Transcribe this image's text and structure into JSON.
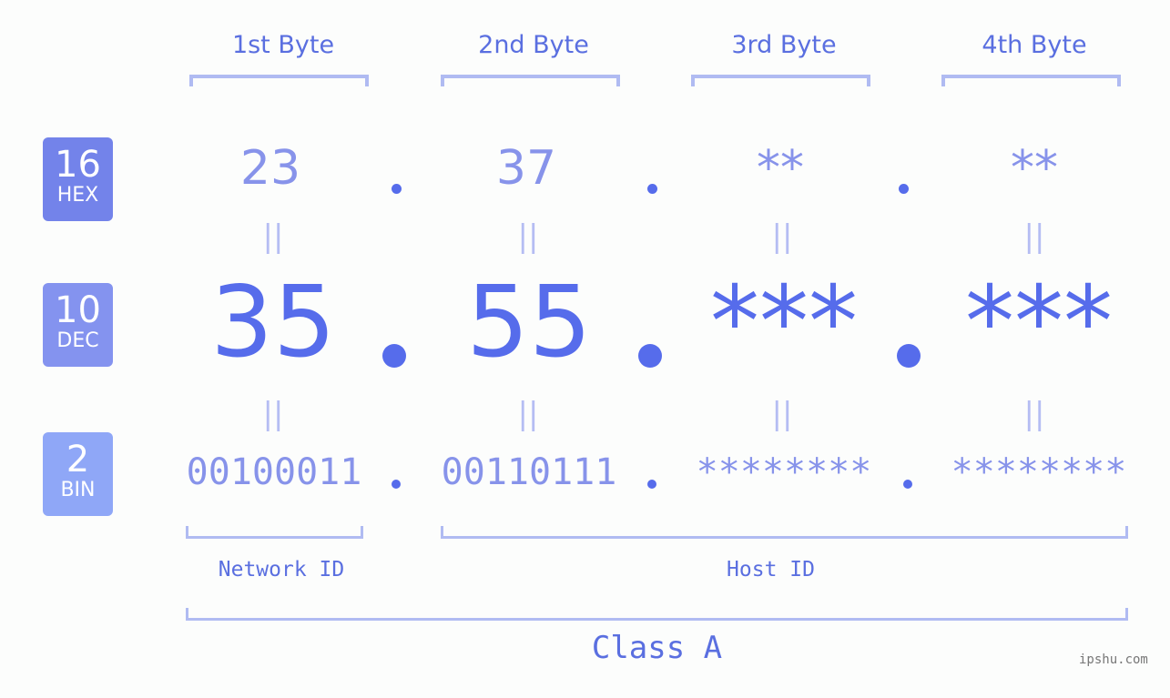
{
  "bytes": [
    {
      "title": "1st Byte",
      "hex": "23",
      "dec": "35",
      "bin": "00100011"
    },
    {
      "title": "2nd Byte",
      "hex": "37",
      "dec": "55",
      "bin": "00110111"
    },
    {
      "title": "3rd Byte",
      "hex": "**",
      "dec": "***",
      "bin": "********"
    },
    {
      "title": "4th Byte",
      "hex": "**",
      "dec": "***",
      "bin": "********"
    }
  ],
  "bases": {
    "hex": {
      "num": "16",
      "label": "HEX",
      "color": "#7383ea"
    },
    "dec": {
      "num": "10",
      "label": "DEC",
      "color": "#8493ef"
    },
    "bin": {
      "num": "2",
      "label": "BIN",
      "color": "#8fa7f7"
    }
  },
  "equals_symbol": "||",
  "network_label": "Network ID",
  "host_label": "Host ID",
  "class_label": "Class A",
  "watermark": "ipshu.com",
  "colors": {
    "accent": "#566ceb",
    "light": "#8793ea",
    "bracket": "#b0bbf2"
  }
}
